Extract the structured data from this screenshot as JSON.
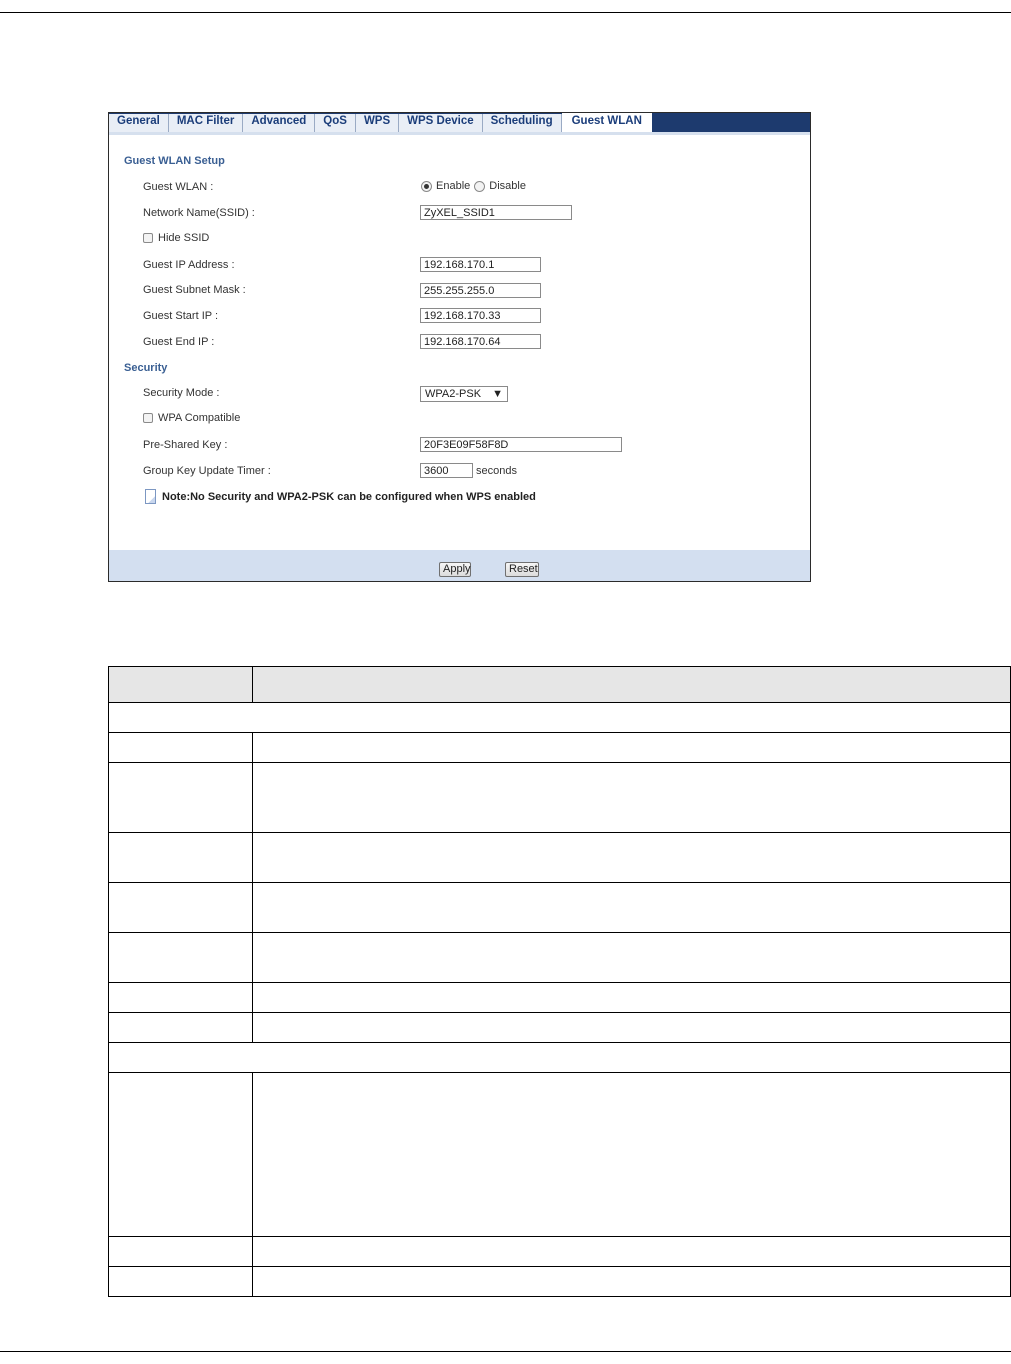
{
  "tabs": [
    {
      "label": "General",
      "active": false
    },
    {
      "label": "MAC Filter",
      "active": false
    },
    {
      "label": "Advanced",
      "active": false
    },
    {
      "label": "QoS",
      "active": false
    },
    {
      "label": "WPS",
      "active": false
    },
    {
      "label": "WPS Device",
      "active": false
    },
    {
      "label": "Scheduling",
      "active": false
    },
    {
      "label": "Guest WLAN",
      "active": true
    }
  ],
  "guest_setup": {
    "title": "Guest WLAN Setup",
    "guest_wlan_label": "Guest WLAN :",
    "enable_label": "Enable",
    "disable_label": "Disable",
    "selected": "Enable",
    "ssid_label": "Network Name(SSID) :",
    "ssid_value": "ZyXEL_SSID1",
    "hide_ssid_label": "Hide SSID",
    "hide_ssid_checked": false,
    "ip_label": "Guest IP Address :",
    "ip_value": "192.168.170.1",
    "mask_label": "Guest Subnet Mask :",
    "mask_value": "255.255.255.0",
    "start_label": "Guest Start IP :",
    "start_value": "192.168.170.33",
    "end_label": "Guest End IP :",
    "end_value": "192.168.170.64"
  },
  "security": {
    "title": "Security",
    "mode_label": "Security Mode :",
    "mode_value": "WPA2-PSK",
    "wpa_compat_label": "WPA Compatible",
    "wpa_compat_checked": false,
    "psk_label": "Pre-Shared Key :",
    "psk_value": "20F3E09F58F8D",
    "timer_label": "Group Key Update Timer :",
    "timer_value": "3600",
    "timer_unit": "seconds",
    "note": "Note:No Security and WPA2-PSK can be configured when WPS enabled"
  },
  "buttons": {
    "apply": "Apply",
    "reset": "Reset"
  },
  "colors": {
    "tab_bar": "#1d3a6e",
    "section_title": "#3a5f93",
    "footer": "#d3dff0"
  }
}
